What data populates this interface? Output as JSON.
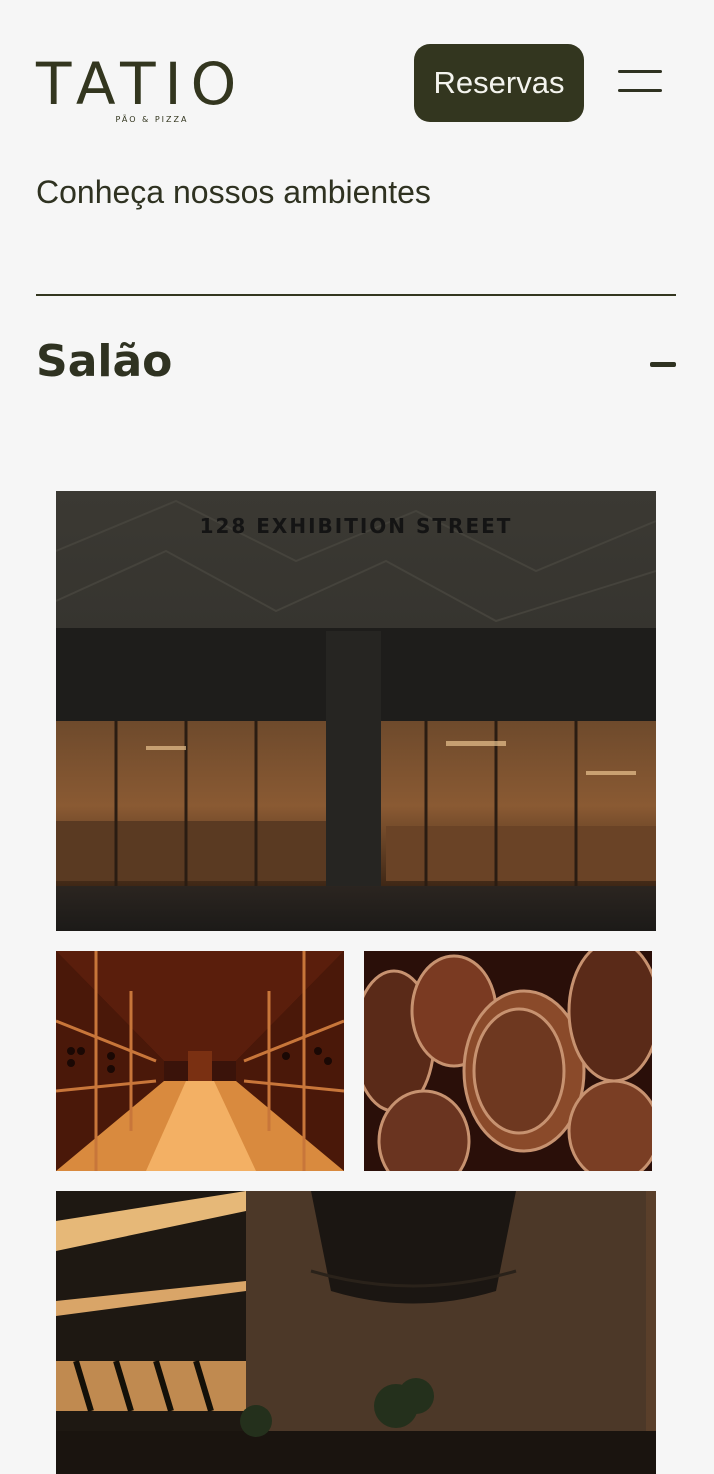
{
  "brand": {
    "name": "TATIO",
    "tagline": "PÃO & PIZZA"
  },
  "header": {
    "reserve_label": "Reservas",
    "menu_icon": "hamburger-icon"
  },
  "intro": {
    "text": "Conheça nossos ambientes"
  },
  "section": {
    "title": "Salão",
    "toggle_icon": "minus-icon"
  },
  "gallery": {
    "photos": [
      {
        "name": "restaurant-facade-photo",
        "sign_text": "128 EXHIBITION STREET"
      },
      {
        "name": "wine-cellar-photo"
      },
      {
        "name": "wine-barrels-photo"
      },
      {
        "name": "dining-interior-photo"
      }
    ]
  },
  "colors": {
    "brand_dark": "#33361f",
    "background": "#f6f6f6",
    "button_text": "#f4f4ee"
  }
}
